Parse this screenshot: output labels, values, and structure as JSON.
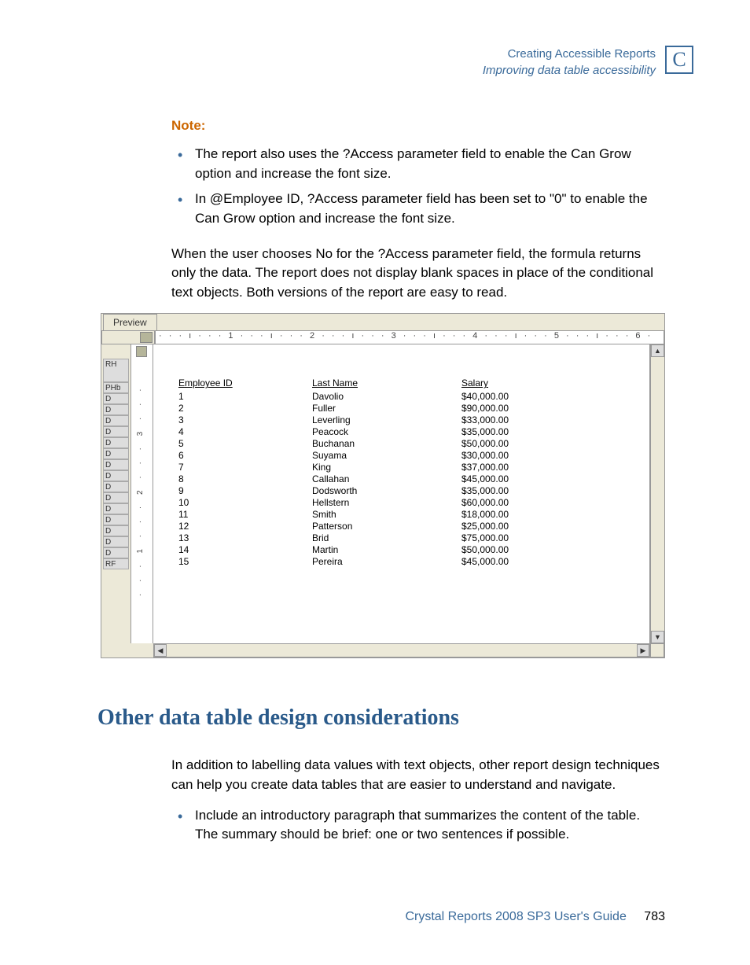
{
  "header": {
    "title": "Creating Accessible Reports",
    "subtitle": "Improving data table accessibility",
    "logo_letter": "C"
  },
  "note": {
    "label": "Note:",
    "items": [
      "The report also uses the ?Access parameter field to enable the Can Grow option and increase the font size.",
      "In @Employee ID, ?Access parameter field has been set to \"0\" to enable the Can Grow option and increase the font size."
    ]
  },
  "intro_paragraph": "When the user chooses No for the ?Access parameter field, the formula returns only the data. The report does not display blank spaces in place of the conditional text objects. Both versions of the report are easy to read.",
  "preview": {
    "tab": "Preview",
    "ruler_h": "· · · ı · · · 1 · · · ı · · · 2 · · · ı · · · 3 · · · ı · · · 4 · · · ı · · · 5 · · · ı · · · 6 ·",
    "sections": [
      "RH",
      "PHb",
      "D",
      "D",
      "D",
      "D",
      "D",
      "D",
      "D",
      "D",
      "D",
      "D",
      "D",
      "D",
      "D",
      "D",
      "D",
      "RF"
    ],
    "ruler_v": "· · · 1 · · · 2 · · · 3 · · ·",
    "headers": {
      "id": "Employee ID",
      "name": "Last Name",
      "salary": "Salary"
    },
    "rows": [
      {
        "id": "1",
        "name": "Davolio",
        "salary": "$40,000.00"
      },
      {
        "id": "2",
        "name": "Fuller",
        "salary": "$90,000.00"
      },
      {
        "id": "3",
        "name": "Leverling",
        "salary": "$33,000.00"
      },
      {
        "id": "4",
        "name": "Peacock",
        "salary": "$35,000.00"
      },
      {
        "id": "5",
        "name": "Buchanan",
        "salary": "$50,000.00"
      },
      {
        "id": "6",
        "name": "Suyama",
        "salary": "$30,000.00"
      },
      {
        "id": "7",
        "name": "King",
        "salary": "$37,000.00"
      },
      {
        "id": "8",
        "name": "Callahan",
        "salary": "$45,000.00"
      },
      {
        "id": "9",
        "name": "Dodsworth",
        "salary": "$35,000.00"
      },
      {
        "id": "10",
        "name": "Hellstern",
        "salary": "$60,000.00"
      },
      {
        "id": "11",
        "name": "Smith",
        "salary": "$18,000.00"
      },
      {
        "id": "12",
        "name": "Patterson",
        "salary": "$25,000.00"
      },
      {
        "id": "13",
        "name": "Brid",
        "salary": "$75,000.00"
      },
      {
        "id": "14",
        "name": "Martin",
        "salary": "$50,000.00"
      },
      {
        "id": "15",
        "name": "Pereira",
        "salary": "$45,000.00"
      }
    ],
    "scroll": {
      "up": "▲",
      "down": "▼",
      "left": "◀",
      "right": "▶"
    }
  },
  "section2": {
    "heading": "Other data table design considerations",
    "paragraph": "In addition to labelling data values with text objects, other report design techniques can help you create data tables that are easier to understand and navigate.",
    "bullets": [
      "Include an introductory paragraph that summarizes the content of the table. The summary should be brief: one or two sentences if possible."
    ]
  },
  "footer": {
    "text": "Crystal Reports 2008 SP3 User's Guide",
    "page": "783"
  }
}
